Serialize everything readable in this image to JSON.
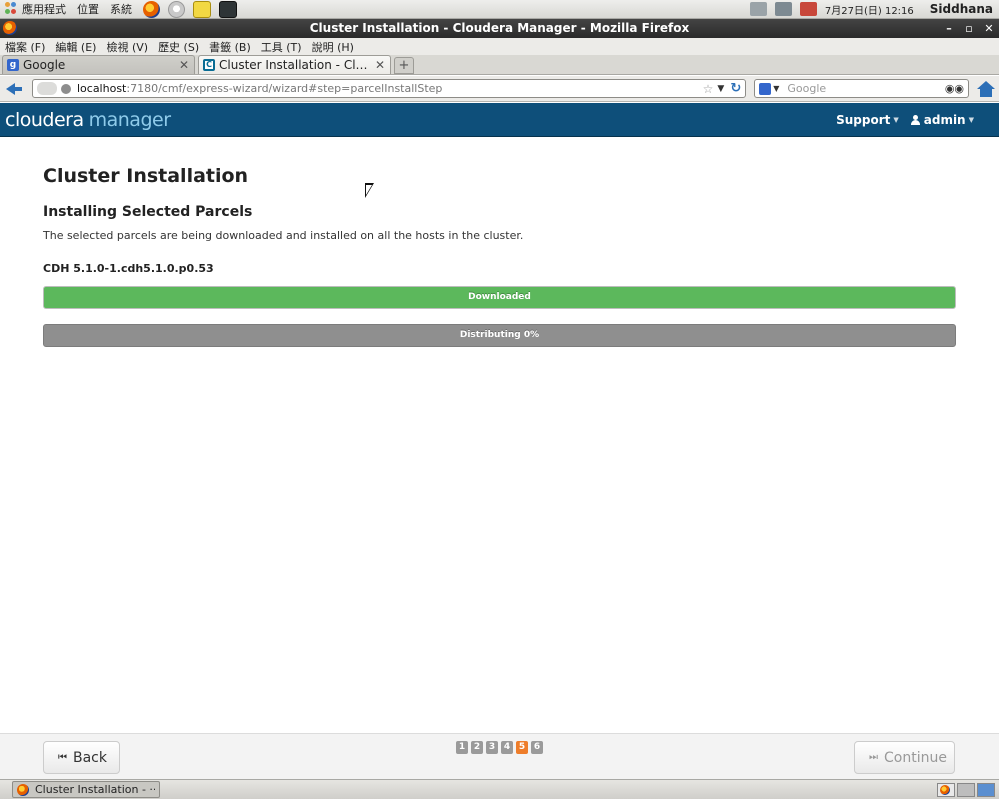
{
  "top_panel": {
    "menus": [
      "應用程式",
      "位置",
      "系統"
    ],
    "clock": "7月27日(日) 12:16",
    "user": "Siddhana"
  },
  "window": {
    "title": "Cluster Installation - Cloudera Manager - Mozilla Firefox"
  },
  "menu_bar": {
    "items": [
      "檔案 (F)",
      "編輯 (E)",
      "檢視 (V)",
      "歷史 (S)",
      "書籤 (B)",
      "工具 (T)",
      "說明 (H)"
    ]
  },
  "tabs": [
    {
      "label": "Google",
      "active": false
    },
    {
      "label": "Cluster Installation - Cloude...",
      "active": true
    }
  ],
  "nav": {
    "url_host": "localhost",
    "url_path": ":7180/cmf/express-wizard/wizard#step=parcelInstallStep",
    "search_placeholder": "Google"
  },
  "header": {
    "logo_part1": "cloudera",
    "logo_part2": "manager",
    "support": "Support",
    "user": "admin"
  },
  "main": {
    "title": "Cluster Installation",
    "section_title": "Installing Selected Parcels",
    "description": "The selected parcels are being downloaded and installed on all the hosts in the cluster.",
    "parcel": "CDH 5.1.0-1.cdh5.1.0.p0.53",
    "progress": [
      {
        "label": "Downloaded",
        "percent": 100,
        "color": "#5cb85c"
      },
      {
        "label": "Distributing 0%",
        "percent": 0,
        "color": "#8f8f8f"
      }
    ]
  },
  "footer": {
    "back": "Back",
    "continue": "Continue",
    "steps": [
      "1",
      "2",
      "3",
      "4",
      "5",
      "6"
    ],
    "active_step": 5
  },
  "taskbar": {
    "task": "Cluster Installation - ···"
  }
}
